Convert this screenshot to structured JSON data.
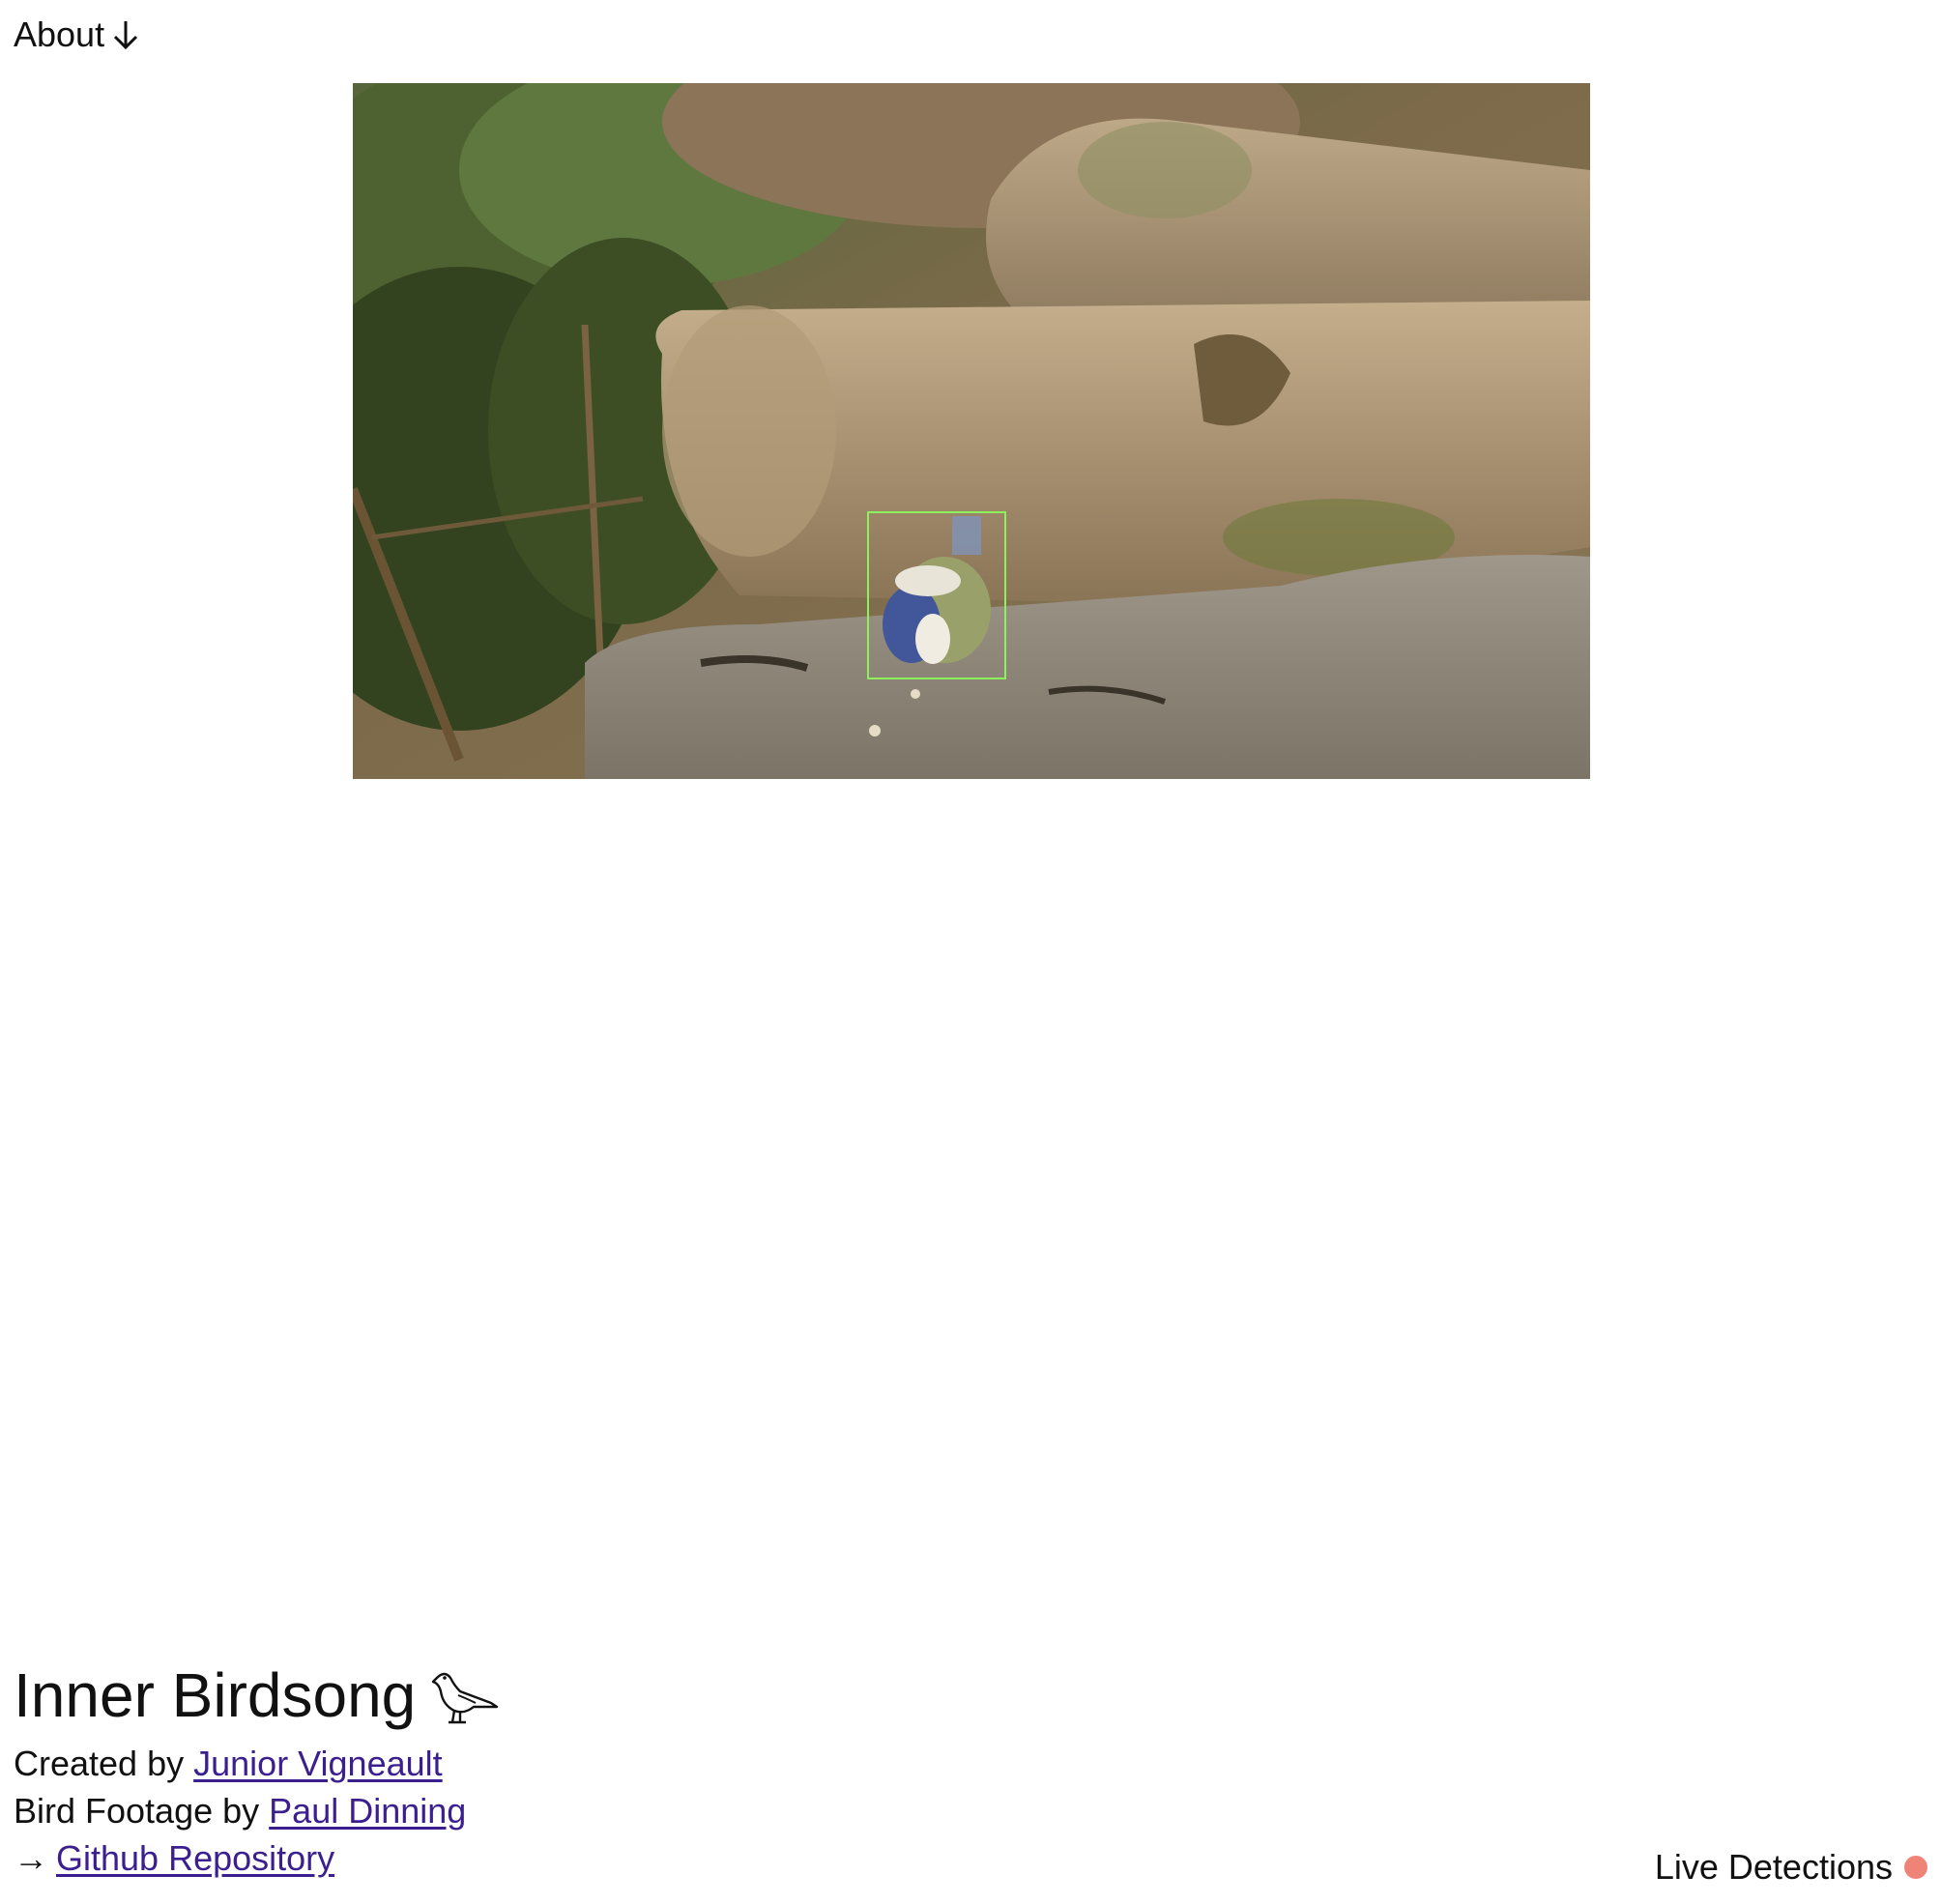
{
  "nav": {
    "about_label": "About",
    "about_icon": "arrow-down-icon"
  },
  "video": {
    "detections": [
      {
        "label": "",
        "color": "#8cf25c"
      }
    ]
  },
  "credits": {
    "title": "Inner Birdsong",
    "title_icon": "bird-icon",
    "created_prefix": "Created by",
    "creator_name": "Junior Vigneault",
    "footage_prefix": "Bird Footage by",
    "footage_name": "Paul Dinning",
    "repo_arrow": "→",
    "repo_label": "Github Repository"
  },
  "status": {
    "label": "Live Detections",
    "indicator_color": "#ef8377"
  }
}
